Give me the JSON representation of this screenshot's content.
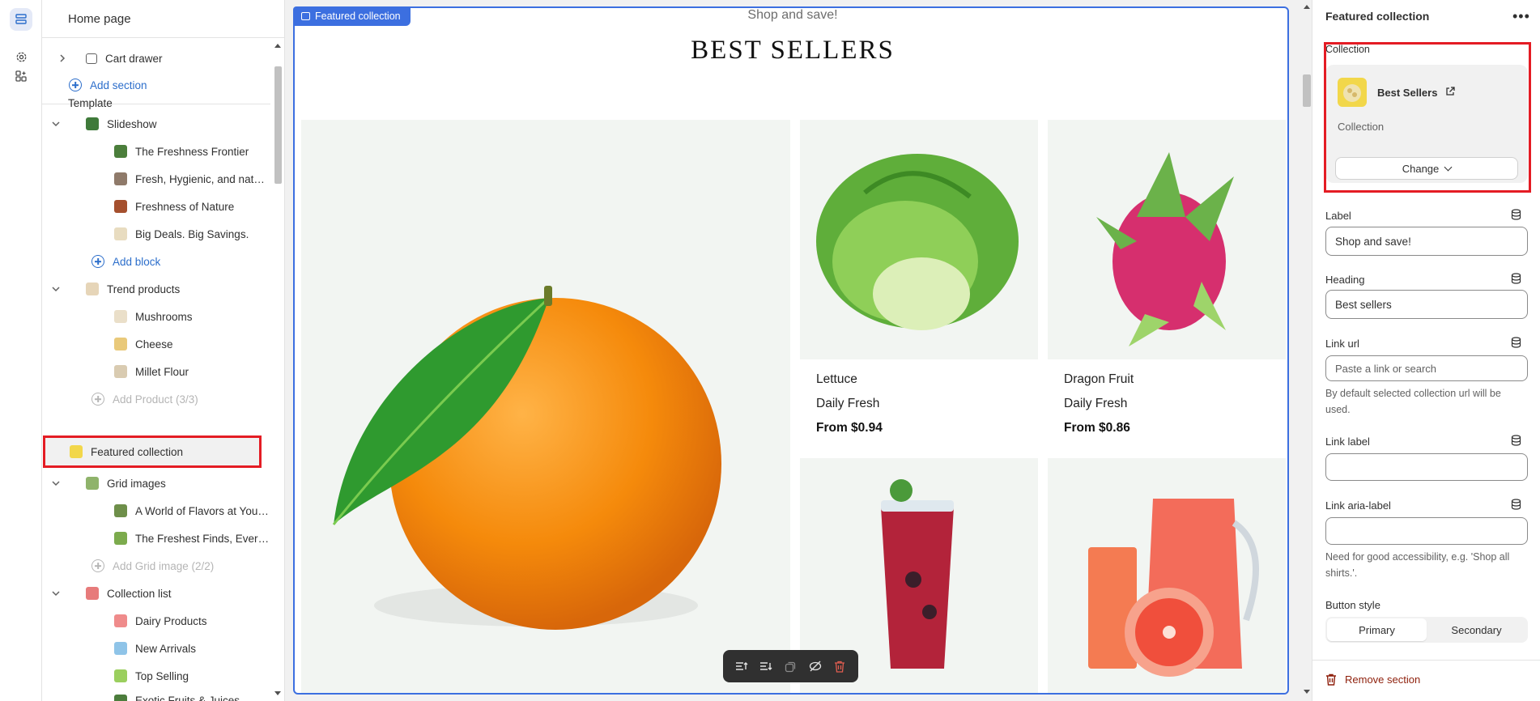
{
  "sidebar": {
    "header": "Home page",
    "cart_drawer": "Cart drawer",
    "add_section": "Add section",
    "template_label": "Template",
    "slideshow": {
      "label": "Slideshow",
      "items": [
        "The Freshness Frontier",
        "Fresh, Hygienic, and natural",
        "Freshness of Nature",
        "Big Deals. Big Savings."
      ],
      "add": "Add block"
    },
    "trend": {
      "label": "Trend products",
      "items": [
        "Mushrooms",
        "Cheese",
        "Millet Flour"
      ],
      "add": "Add Product (3/3)"
    },
    "featured": "Featured collection",
    "grid": {
      "label": "Grid images",
      "items": [
        "A World of Flavors at Your Fi...",
        "The Freshest Finds, Every Time"
      ],
      "add": "Add Grid image (2/2)"
    },
    "collection_list": {
      "label": "Collection list",
      "items": [
        "Dairy Products",
        "New Arrivals",
        "Top Selling",
        "Exotic Fruits & Juices"
      ]
    }
  },
  "preview": {
    "tag": "Featured collection",
    "subheading": "Shop and save!",
    "heading": "BEST SELLERS",
    "products": [
      {
        "name": "Lettuce",
        "sub": "Daily Fresh",
        "price": "From $0.94"
      },
      {
        "name": "Dragon Fruit",
        "sub": "Daily Fresh",
        "price": "From $0.86"
      }
    ]
  },
  "settings": {
    "title": "Featured collection",
    "more": "•••",
    "collection_label": "Collection",
    "collection_name": "Best Sellers",
    "collection_type": "Collection",
    "change": "Change",
    "label_label": "Label",
    "label_value": "Shop and save!",
    "heading_label": "Heading",
    "heading_value": "Best sellers",
    "link_url_label": "Link url",
    "link_url_placeholder": "Paste a link or search",
    "link_url_help": "By default selected collection url will be used.",
    "link_label_label": "Link label",
    "link_label_value": "",
    "aria_label": "Link aria-label",
    "aria_value": "",
    "aria_help": "Need for good accessibility, e.g. 'Shop all shirts.'.",
    "button_style_label": "Button style",
    "button_styles": [
      "Primary",
      "Secondary"
    ],
    "remove": "Remove section"
  },
  "colors": {
    "accent": "#2c6ecb",
    "selection": "#3c6fe0",
    "highlight": "#e41c24",
    "danger": "#8e1f0b"
  }
}
